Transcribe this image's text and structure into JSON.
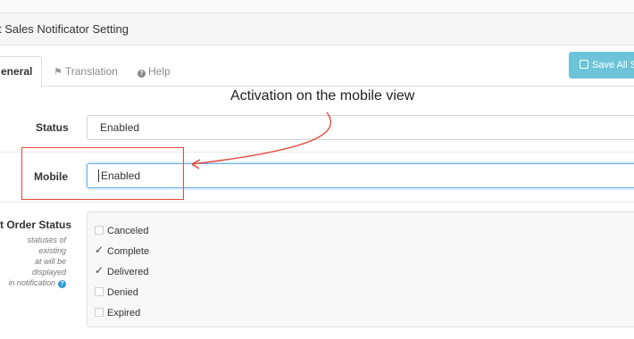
{
  "header": {
    "title": "t Sales Notificator Setting"
  },
  "tabs": [
    {
      "label": "eneral",
      "active": true
    },
    {
      "label": "Translation",
      "icon": "flag-icon"
    },
    {
      "label": "Help",
      "icon": "question-circle-icon"
    }
  ],
  "toolbar": {
    "save_label": "Save All Se",
    "save_icon": "save-icon"
  },
  "annotation": {
    "text": "Activation on the mobile view",
    "color": "#e3483b"
  },
  "form": {
    "status": {
      "label": "Status",
      "value": "Enabled"
    },
    "mobile": {
      "label": "Mobile",
      "value": "Enabled"
    },
    "order_status": {
      "label": "t Order Status",
      "help_lines": [
        "statuses of existing",
        "at will be displayed",
        "in notification"
      ],
      "options": [
        {
          "label": "Canceled",
          "checked": false
        },
        {
          "label": "Complete",
          "checked": true
        },
        {
          "label": "Delivered",
          "checked": true
        },
        {
          "label": "Denied",
          "checked": false
        },
        {
          "label": "Expired",
          "checked": false
        }
      ]
    }
  },
  "colors": {
    "accent": "#6dc4d8",
    "focus": "#66afe9",
    "annotation": "#e3483b",
    "help_icon": "#2e9ad0"
  }
}
